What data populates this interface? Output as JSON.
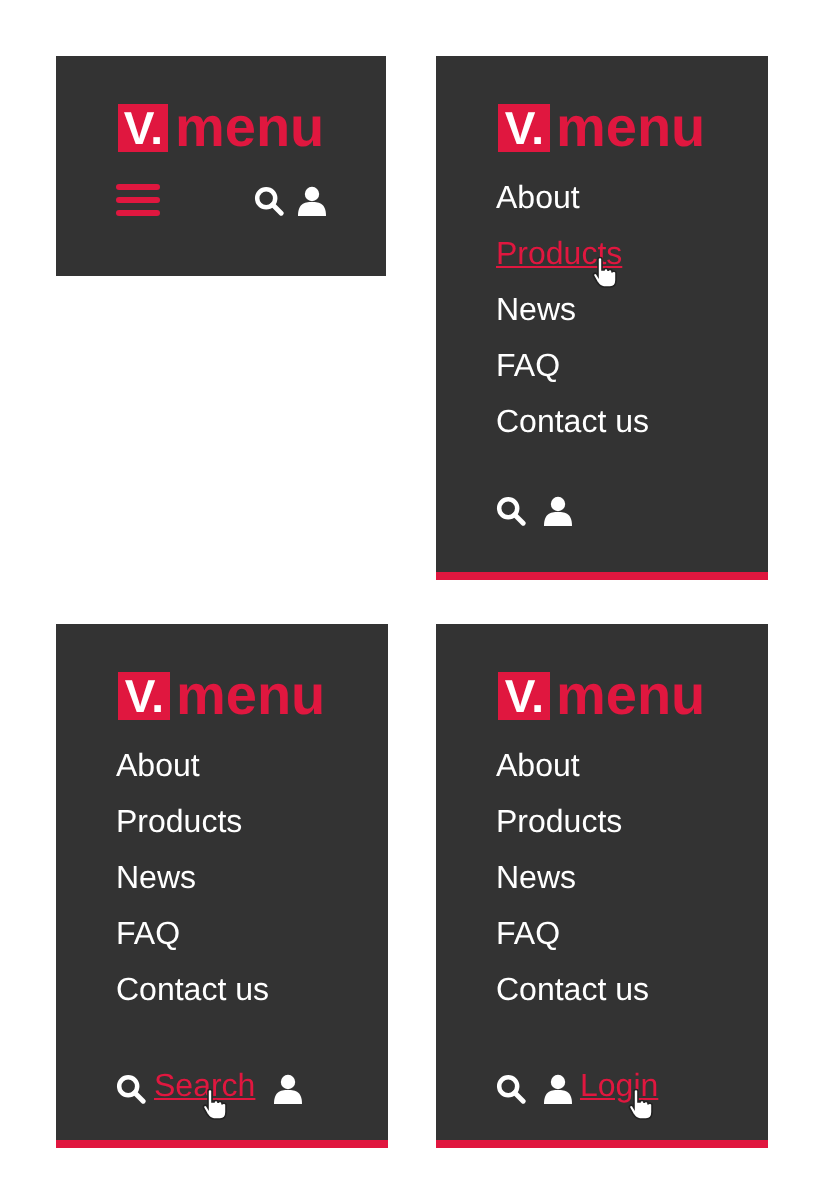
{
  "panels": [
    {
      "kind": "collapsed",
      "logo": {
        "mark": "V.",
        "word": "menu"
      },
      "tools": [
        {
          "kind": "search"
        },
        {
          "kind": "user"
        }
      ]
    },
    {
      "kind": "expanded",
      "logo": {
        "mark": "V.",
        "word": "menu"
      },
      "nav": [
        {
          "label": "About",
          "hovered": false
        },
        {
          "label": "Products",
          "hovered": true
        },
        {
          "label": "News",
          "hovered": false
        },
        {
          "label": "FAQ",
          "hovered": false
        },
        {
          "label": "Contact us",
          "hovered": false
        }
      ],
      "tools": [
        {
          "kind": "search"
        },
        {
          "kind": "user"
        }
      ]
    },
    {
      "kind": "expanded",
      "logo": {
        "mark": "V.",
        "word": "menu"
      },
      "nav": [
        {
          "label": "About",
          "hovered": false
        },
        {
          "label": "Products",
          "hovered": false
        },
        {
          "label": "News",
          "hovered": false
        },
        {
          "label": "FAQ",
          "hovered": false
        },
        {
          "label": "Contact us",
          "hovered": false
        }
      ],
      "tools": [
        {
          "kind": "search",
          "label": "Search"
        },
        {
          "kind": "user"
        }
      ]
    },
    {
      "kind": "expanded",
      "logo": {
        "mark": "V.",
        "word": "menu"
      },
      "nav": [
        {
          "label": "About",
          "hovered": false
        },
        {
          "label": "Products",
          "hovered": false
        },
        {
          "label": "News",
          "hovered": false
        },
        {
          "label": "FAQ",
          "hovered": false
        },
        {
          "label": "Contact us",
          "hovered": false
        }
      ],
      "tools": [
        {
          "kind": "search"
        },
        {
          "kind": "user",
          "label": "Login"
        }
      ]
    }
  ]
}
